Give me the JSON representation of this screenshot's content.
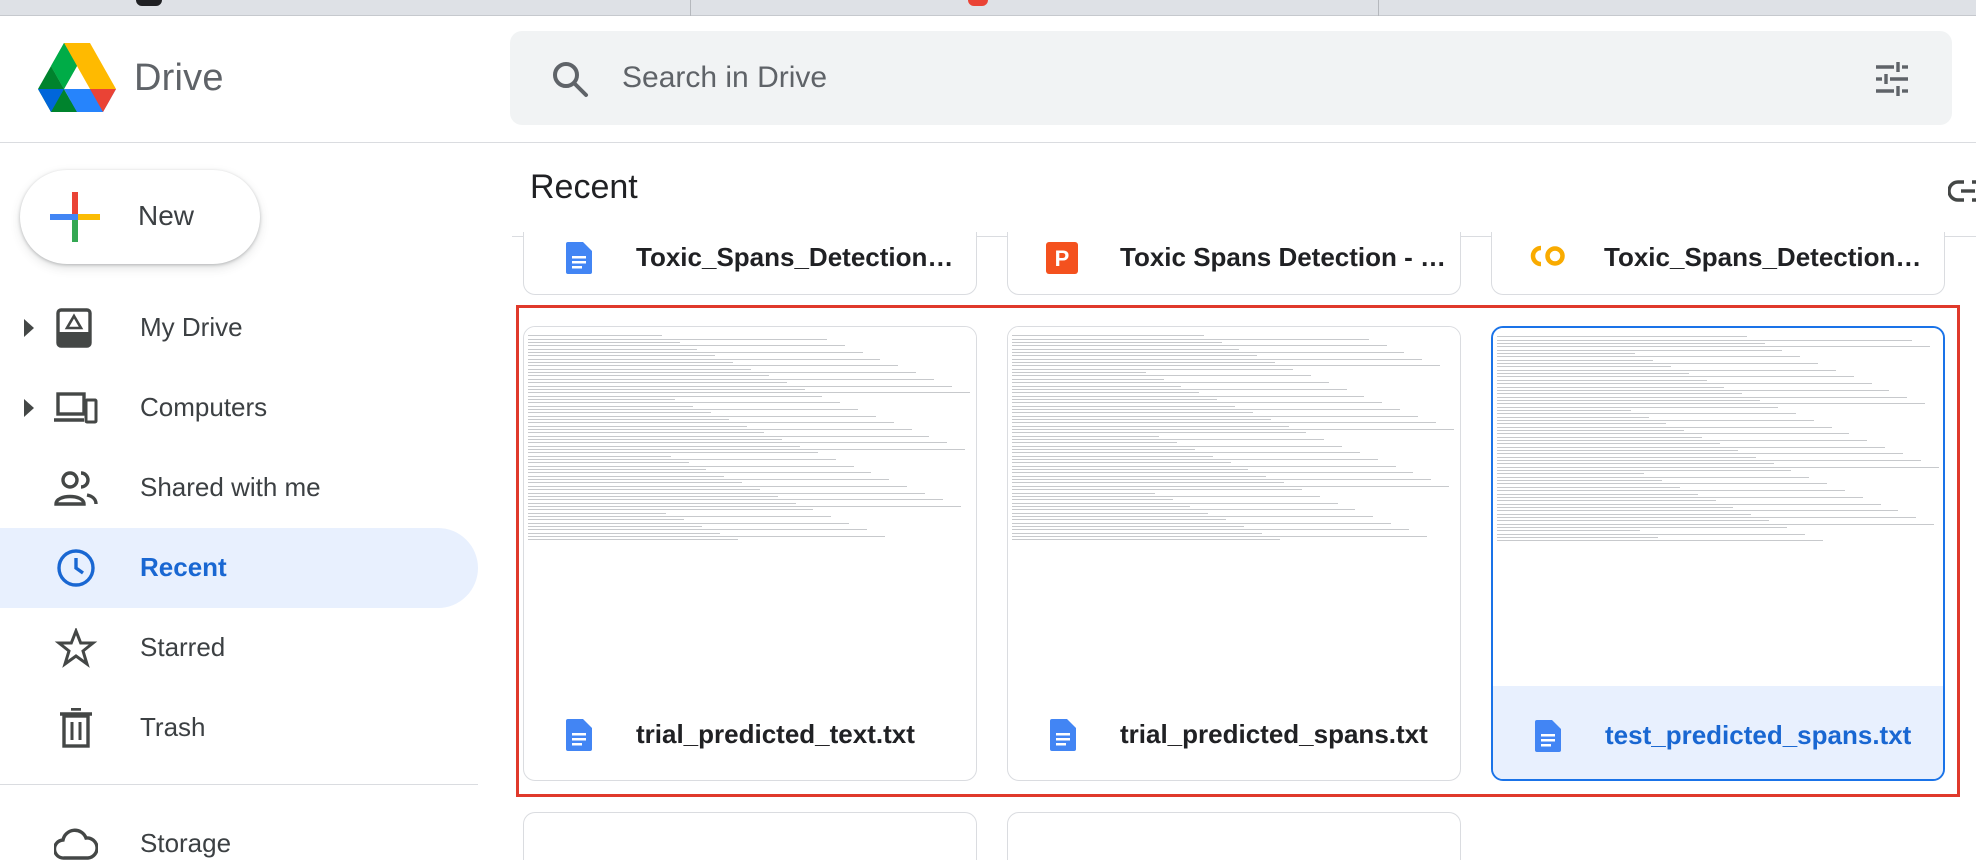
{
  "app": {
    "logo_text": "Drive"
  },
  "search": {
    "placeholder": "Search in Drive"
  },
  "sidebar": {
    "new_label": "New",
    "items": [
      {
        "label": "My Drive",
        "icon": "my-drive-icon"
      },
      {
        "label": "Computers",
        "icon": "computers-icon"
      },
      {
        "label": "Shared with me",
        "icon": "shared-with-me-icon"
      },
      {
        "label": "Recent",
        "icon": "recent-icon",
        "active": true
      },
      {
        "label": "Starred",
        "icon": "starred-icon"
      },
      {
        "label": "Trash",
        "icon": "trash-icon"
      },
      {
        "label": "Storage",
        "icon": "storage-icon"
      }
    ]
  },
  "main": {
    "title": "Recent",
    "top_row": [
      {
        "name": "Toxic_Spans_Detection_P...",
        "type": "doc"
      },
      {
        "name": "Toxic Spans Detection - S...",
        "type": "slides"
      },
      {
        "name": "Toxic_Spans_Detection_P...",
        "type": "colab"
      }
    ],
    "mid_row": [
      {
        "name": "trial_predicted_text.txt",
        "type": "doc"
      },
      {
        "name": "trial_predicted_spans.txt",
        "type": "doc"
      },
      {
        "name": "test_predicted_spans.txt",
        "type": "doc",
        "selected": true
      }
    ]
  },
  "colors": {
    "accent": "#1a73e8",
    "active_bg": "#e8f0fe",
    "highlight": "#e0392b",
    "doc_blue": "#4285f4",
    "slides_orange": "#f4511e",
    "colab_yellow": "#f9ab00"
  }
}
